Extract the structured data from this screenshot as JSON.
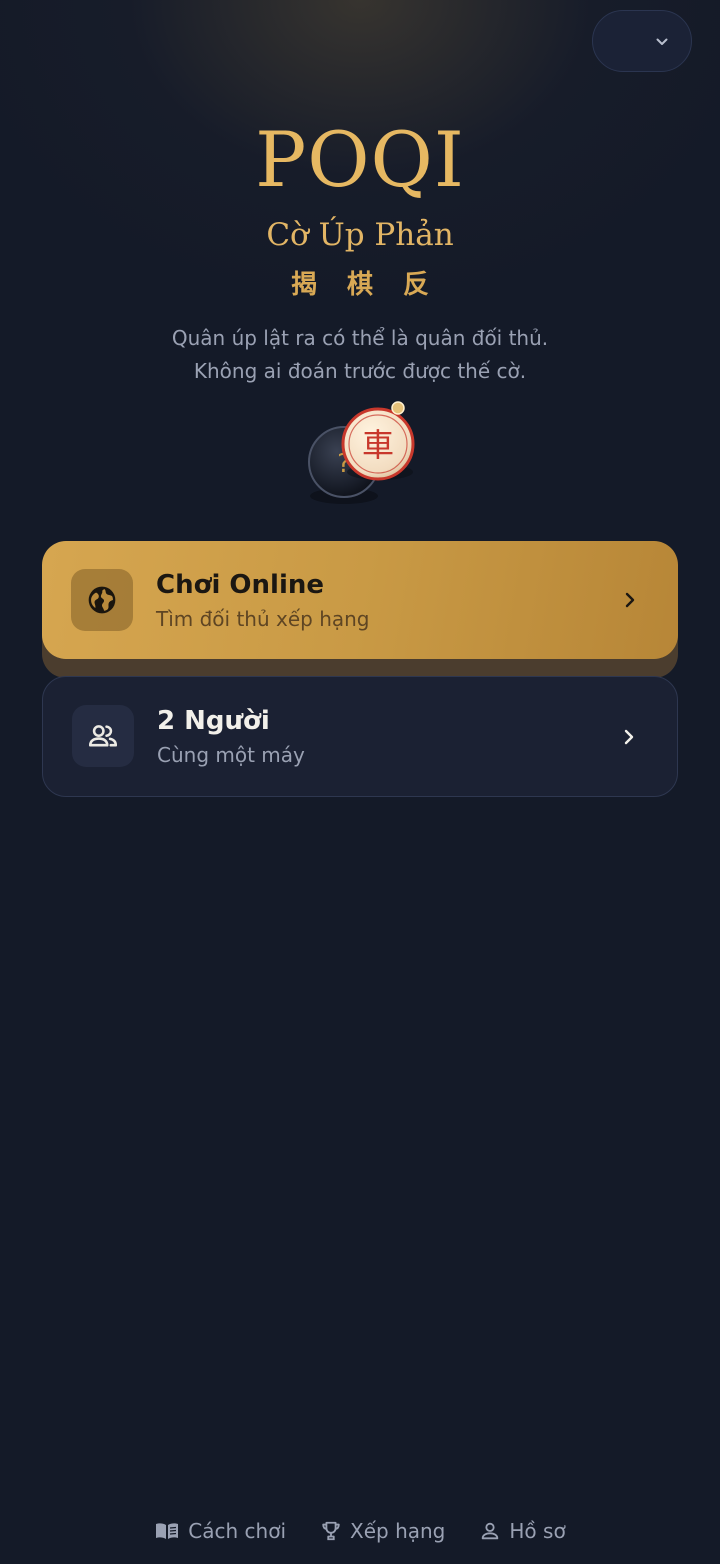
{
  "header": {
    "language_selector_icon": "chevron-down-icon"
  },
  "hero": {
    "logo": "POQI",
    "subtitle": "Cờ Úp Phản",
    "hanzi": "揭棋反",
    "description_lines": [
      "Quân úp lật ra có thể là quân đối thủ.",
      "Không ai đoán trước được thế cờ."
    ],
    "piece_glyph": "車"
  },
  "modes": [
    {
      "title": "Chơi Online",
      "subtitle": "Tìm đối thủ xếp hạng",
      "icon": "globe-icon"
    },
    {
      "title": "2 Người",
      "subtitle": "Cùng một máy",
      "icon": "users-icon"
    }
  ],
  "bottom_nav": [
    {
      "label": "Cách chơi",
      "icon": "book-icon"
    },
    {
      "label": "Xếp hạng",
      "icon": "trophy-icon"
    },
    {
      "label": "Hồ sơ",
      "icon": "user-icon"
    }
  ],
  "colors": {
    "background": "#141a28",
    "gold": "#e6b862",
    "card_online": "#c99a45",
    "piece_red": "#c8382c"
  }
}
